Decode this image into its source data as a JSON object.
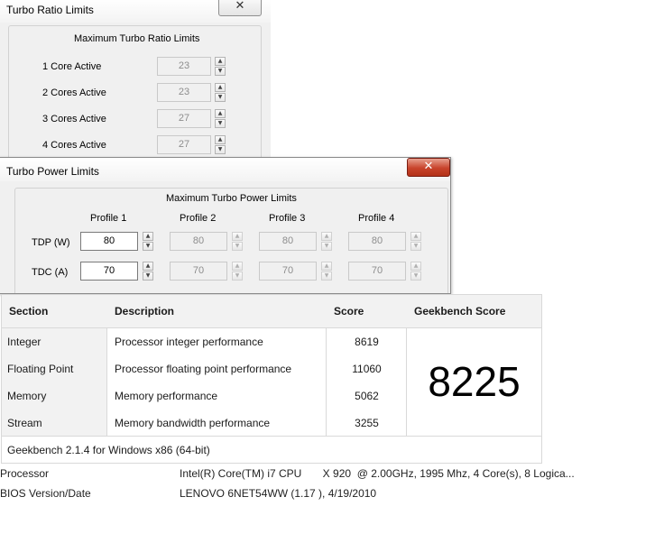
{
  "turbo_ratio": {
    "title": "Turbo Ratio Limits",
    "group_label": "Maximum Turbo Ratio Limits",
    "rows": [
      {
        "label": "1 Core Active",
        "value": "23"
      },
      {
        "label": "2 Cores Active",
        "value": "23"
      },
      {
        "label": "3 Cores Active",
        "value": "27"
      },
      {
        "label": "4 Cores Active",
        "value": "27"
      }
    ],
    "close_glyph": "✕"
  },
  "turbo_power": {
    "title": "Turbo Power Limits",
    "group_label": "Maximum Turbo Power Limits",
    "profiles": [
      "Profile 1",
      "Profile 2",
      "Profile 3",
      "Profile 4"
    ],
    "tdp_label": "TDP (W)",
    "tdc_label": "TDC (A)",
    "tdp_values": [
      "80",
      "80",
      "80",
      "80"
    ],
    "tdc_values": [
      "70",
      "70",
      "70",
      "70"
    ],
    "close_glyph": "✕"
  },
  "geekbench": {
    "headers": {
      "section": "Section",
      "description": "Description",
      "score": "Score",
      "geekbench_score": "Geekbench Score"
    },
    "rows": [
      {
        "section": "Integer",
        "description": "Processor integer performance",
        "score": "8619"
      },
      {
        "section": "Floating Point",
        "description": "Processor floating point performance",
        "score": "11060"
      },
      {
        "section": "Memory",
        "description": "Memory performance",
        "score": "5062"
      },
      {
        "section": "Stream",
        "description": "Memory bandwidth performance",
        "score": "3255"
      }
    ],
    "total_score": "8225",
    "footer": "Geekbench 2.1.4 for Windows x86 (64-bit)"
  },
  "system_info": {
    "processor_label": "Processor",
    "processor_value": "Intel(R) Core(TM) i7 CPU       X 920  @ 2.00GHz, 1995 Mhz, 4 Core(s), 8 Logica...",
    "bios_label": "BIOS Version/Date",
    "bios_value": "LENOVO 6NET54WW (1.17 ), 4/19/2010"
  },
  "colors": {
    "close_active": "#c8432b",
    "table_header_bg": "#f2f2f2",
    "window_bg": "#f0f0f0"
  },
  "icons": {
    "spin_up": "up-arrow-icon",
    "spin_down": "down-arrow-icon"
  }
}
